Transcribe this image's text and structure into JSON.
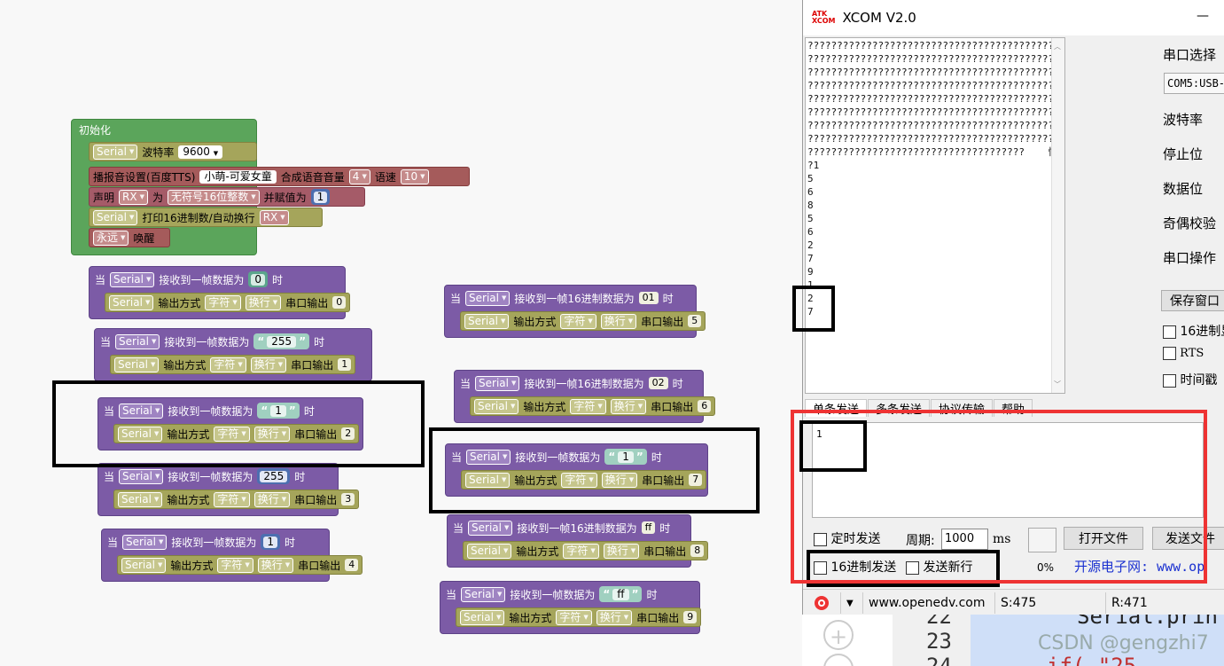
{
  "init": {
    "title": "初始化",
    "serial": "Serial",
    "baud_label": "波特率",
    "baud": "9600",
    "tts_label": "播报音设置(百度TTS)",
    "voice": "小萌-可爱女童",
    "volume_label": "合成语音音量",
    "volume": "4",
    "speed_label": "语速",
    "speed": "10",
    "declare_label": "声明",
    "var_name": "RX",
    "as_label": "为",
    "var_type": "无符号16位整数",
    "assign_label": "并赋值为",
    "assign_value": "1",
    "print_label": "打印16进制数/自动换行",
    "print_var": "RX",
    "forever": "永远",
    "wake": "唤醒"
  },
  "common": {
    "when": "当",
    "serial": "Serial",
    "recv_frame": "接收到一帧数据为",
    "recv_frame_hex": "接收到一帧16进制数据为",
    "then": "时",
    "output_mode": "输出方式",
    "char": "字符",
    "newline": "换行",
    "serial_out": "串口输出"
  },
  "blocks": [
    {
      "value": "0",
      "out": "0"
    },
    {
      "value": "255",
      "out": "1"
    },
    {
      "value": "1",
      "out": "2"
    },
    {
      "value": "255",
      "out": "3"
    },
    {
      "value": "1",
      "out": "4"
    },
    {
      "value": "01",
      "out": "5"
    },
    {
      "value": "02",
      "out": "6"
    },
    {
      "value": "1",
      "out": "7"
    },
    {
      "value": "ff",
      "out": "8"
    },
    {
      "value": "ff",
      "out": "9"
    }
  ],
  "xcom": {
    "logo_top": "ATK",
    "logo_bottom": "XCOM",
    "title": "XCOM V2.0",
    "minimize": "—",
    "recv_lines": [
      "??????????????????????????????????????????????",
      "??????????????????????????????????????????????",
      "??????????????????????????????????????????????",
      "??????????????????????????????????????????????",
      "??????????????????????????????????????????????",
      "??????????????????????????????????????????????",
      "??????????????????????????????????????????????",
      "??????????????????????????????????????????????",
      "?????????????????????????????????????    愓杍杍",
      "?1",
      "5",
      "6",
      "8",
      "5",
      "6",
      "2",
      "7",
      "9",
      "1",
      "2",
      "7"
    ],
    "side": {
      "port_select": "串口选择",
      "port_value": "COM5:USB-",
      "baud": "波特率",
      "stop_bits": "停止位",
      "data_bits": "数据位",
      "parity": "奇偶校验",
      "port_op": "串口操作",
      "save_window": "保存窗口",
      "hex_display": "16进制显",
      "rts": "RTS",
      "timestamp": "时间戳"
    },
    "tabs": [
      "单条发送",
      "多条发送",
      "协议传输",
      "帮助"
    ],
    "send_text": "1",
    "timed_send": "定时发送",
    "period_label": "周期:",
    "period": "1000",
    "ms": "ms",
    "open_file": "打开文件",
    "send_file": "发送文件",
    "hex_send": "16进制发送",
    "send_newline": "发送新行",
    "percent": "0%",
    "site_banner": "开源电子网: www.op",
    "status_url": "www.openedv.com",
    "sent": "S:475",
    "received": "R:471"
  },
  "code": {
    "line1_no": "22",
    "line1": "Serial.prin",
    "line2_no": "23",
    "line3_no": "24",
    "line3": "if(      \"25",
    "watermark": "CSDN @gengzhi7"
  }
}
